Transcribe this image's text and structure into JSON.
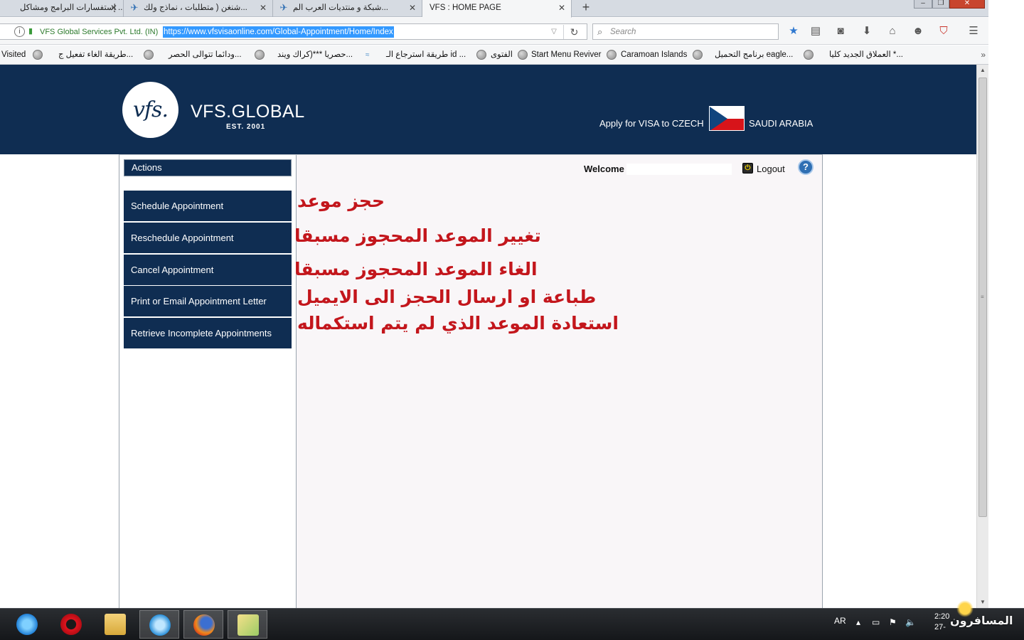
{
  "browser": {
    "tabs": [
      {
        "title": "إستفسارات البرامج ومشاكل ...",
        "active": false
      },
      {
        "title": "شنغن ( متطلبات ، نماذج ولك...",
        "active": false
      },
      {
        "title": "شبكة و منتديات العرب الم...",
        "active": false
      },
      {
        "title": "VFS : HOME PAGE",
        "active": true
      }
    ],
    "new_tab_label": "+",
    "window_controls": {
      "minimize": "–",
      "maximize": "❐",
      "close": "✕"
    },
    "identity_label": "VFS Global Services Pvt. Ltd. (IN)",
    "url": "https://www.vfsvisaonline.com/Global-Appointment/Home/Index",
    "search_placeholder": "Search",
    "toolbar_icons": [
      "star-icon",
      "reading-list-icon",
      "pocket-icon",
      "download-icon",
      "home-icon",
      "chat-icon",
      "shield-icon",
      "menu-icon"
    ],
    "bookmarks": [
      "Visited",
      "طريقة الغاء تفعيل ج...",
      "ودائما تتوالى الحصر...",
      "حصريا ***(كراك ويند...",
      "طريقة استرجاع الـ id ...",
      "الفتوى",
      "Start Menu Reviver",
      "Caramoan Islands",
      "برنامج التحميل eagle...",
      "العملاق الجديد كليا *..."
    ]
  },
  "site": {
    "logo_mark": "vfs.",
    "logo_word": "VFS.GLOBAL",
    "logo_est": "EST. 2001",
    "apply_text": "Apply for VISA to CZECH",
    "country": "SAUDI ARABIA",
    "flag_colors": {
      "white": "#ffffff",
      "red": "#d7141a",
      "blue": "#11457e"
    },
    "brand_color": "#0f2d52"
  },
  "panel": {
    "actions_title": "Actions",
    "actions": [
      "Schedule Appointment",
      "Reschedule Appointment",
      "Cancel Appointment",
      "Print or Email Appointment Letter",
      "Retrieve Incomplete Appointments"
    ],
    "welcome_label": "Welcome",
    "logout_label": "Logout",
    "help_label": "?"
  },
  "annotations": [
    "حجز موعد",
    "تغيير الموعد المحجوز مسبقا",
    "الغاء الموعد المحجوز مسبقا",
    "طباعة او ارسال الحجز الى الايميل",
    "استعادة الموعد الذي لم يتم استكماله"
  ],
  "taskbar": {
    "apps": [
      "internet-explorer-icon",
      "opera-icon",
      "file-explorer-icon",
      "network-app-icon",
      "firefox-icon",
      "folder-app-icon"
    ],
    "language": "AR",
    "clock_time": "2:20",
    "clock_date": "27-"
  }
}
